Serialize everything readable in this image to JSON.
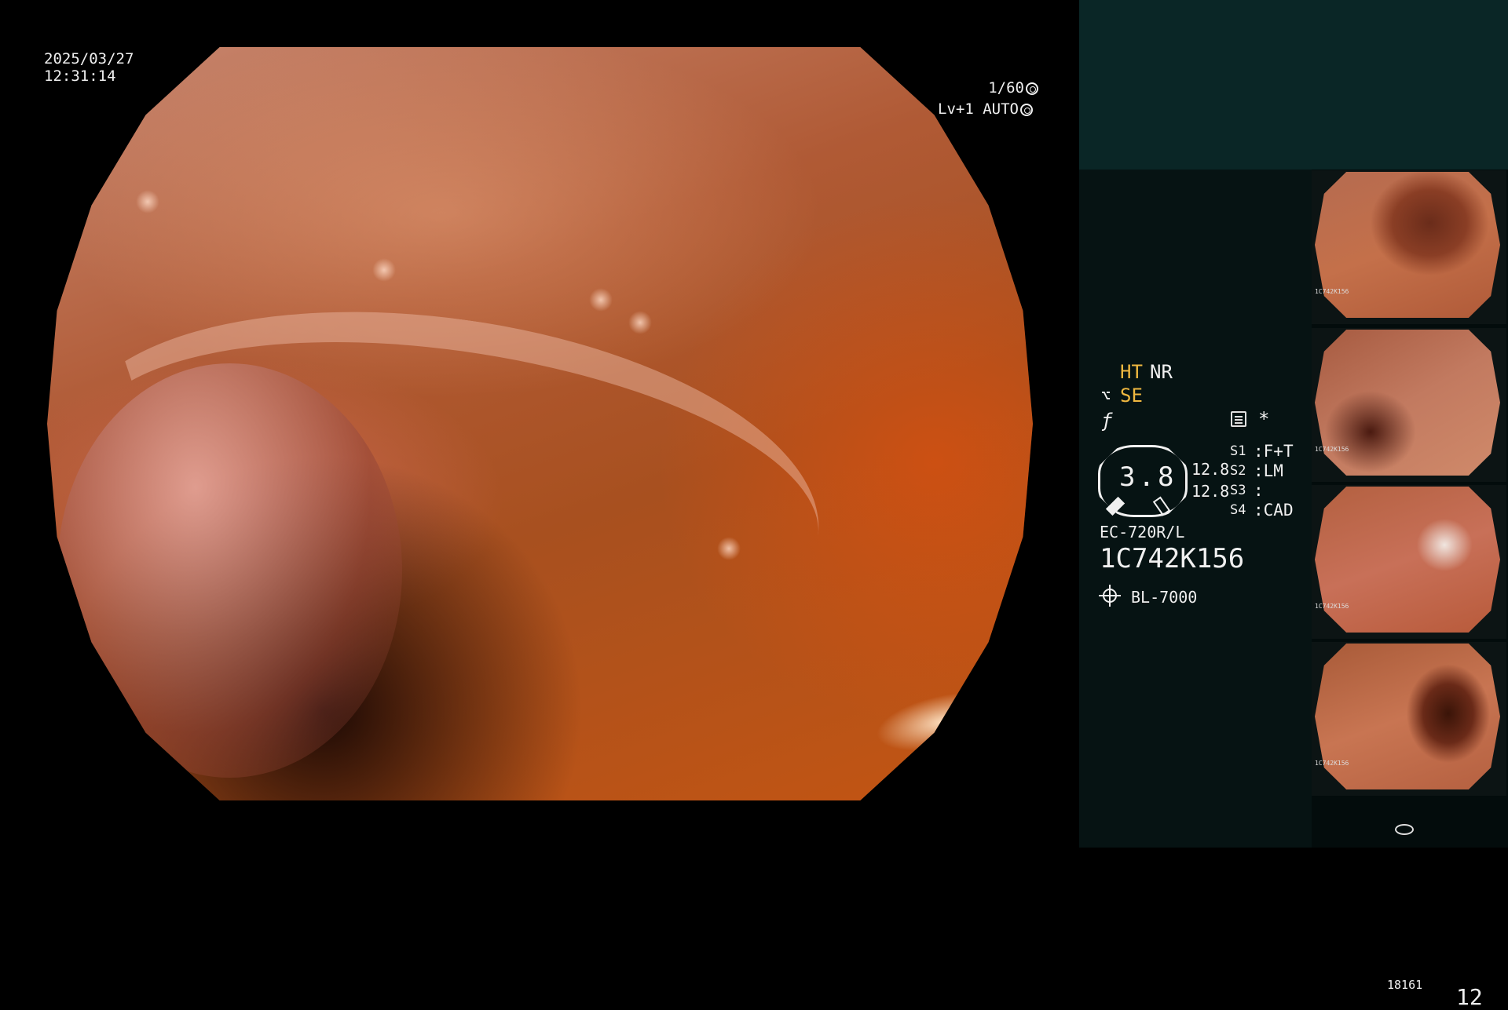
{
  "osd": {
    "date": "2025/03/27",
    "time": "12:31:14",
    "shutter": "1/60",
    "level": "Lv+1",
    "exposure_mode": "AUTO"
  },
  "processor": {
    "ht_label": "HT",
    "nr_label": "NR",
    "se_label": "SE",
    "zoom_value": "3.8",
    "channel_diameter_1": "12.8",
    "channel_diameter_2": "12.8",
    "switches": [
      {
        "id": "S1",
        "value": "F+T"
      },
      {
        "id": "S2",
        "value": "LM"
      },
      {
        "id": "S3",
        "value": ""
      },
      {
        "id": "S4",
        "value": "CAD"
      }
    ],
    "scope_model": "EC-720R/L",
    "scope_serial": "1C742K156",
    "light_source": "BL-7000",
    "storage_count": "18161",
    "image_count": "12"
  },
  "colors": {
    "highlight_yellow": "#f0b840",
    "panel_bg": "#061313",
    "panel_top_bg": "#0a2626"
  },
  "thumbnails": [
    {
      "serial": "1C742K156"
    },
    {
      "serial": "1C742K156"
    },
    {
      "serial": "1C742K156"
    },
    {
      "serial": "1C742K156"
    }
  ]
}
